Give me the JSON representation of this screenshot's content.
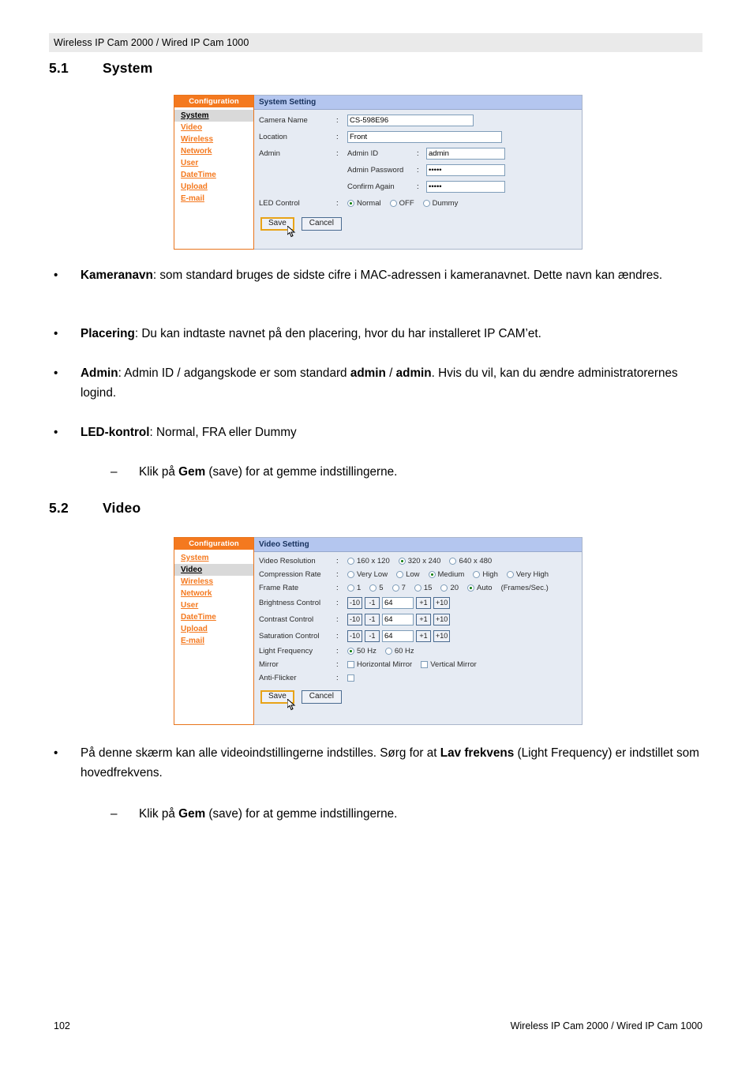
{
  "page": {
    "running_header": "Wireless IP Cam 2000 / Wired IP Cam 1000",
    "footer_page_number": "102",
    "footer_right": "Wireless IP Cam 2000 / Wired IP Cam 1000"
  },
  "sections": [
    {
      "number": "5.1",
      "title": "System"
    },
    {
      "number": "5.2",
      "title": "Video"
    }
  ],
  "colors": {
    "nav_orange": "#f4791f",
    "panel_title_blue": "#b4c6ef",
    "panel_bg": "#e6ebf3",
    "focus_gold": "#e8a317",
    "radio_dot_green": "#0a7a0a"
  },
  "system_screenshot": {
    "nav": {
      "title": "Configuration",
      "items": [
        {
          "label": "System",
          "active": true
        },
        {
          "label": "Video",
          "active": false
        },
        {
          "label": "Wireless",
          "active": false
        },
        {
          "label": "Network",
          "active": false
        },
        {
          "label": "User",
          "active": false
        },
        {
          "label": "DateTime",
          "active": false
        },
        {
          "label": "Upload",
          "active": false
        },
        {
          "label": "E-mail",
          "active": false
        }
      ]
    },
    "panel_title": "System Setting",
    "fields": {
      "camera_name_label": "Camera Name",
      "camera_name_value": "CS-598E96",
      "location_label": "Location",
      "location_value": "Front",
      "admin_label": "Admin",
      "admin_id_label": "Admin ID",
      "admin_id_value": "admin",
      "admin_password_label": "Admin Password",
      "admin_password_value": "•••••",
      "confirm_again_label": "Confirm Again",
      "confirm_again_value": "•••••",
      "led_control_label": "LED Control",
      "led_options": [
        {
          "label": "Normal",
          "selected": true
        },
        {
          "label": "OFF",
          "selected": false
        },
        {
          "label": "Dummy",
          "selected": false
        }
      ],
      "colon": ":"
    },
    "buttons": {
      "save": "Save",
      "cancel": "Cancel"
    }
  },
  "video_screenshot": {
    "nav": {
      "title": "Configuration",
      "items": [
        {
          "label": "System",
          "active": false
        },
        {
          "label": "Video",
          "active": true
        },
        {
          "label": "Wireless",
          "active": false
        },
        {
          "label": "Network",
          "active": false
        },
        {
          "label": "User",
          "active": false
        },
        {
          "label": "DateTime",
          "active": false
        },
        {
          "label": "Upload",
          "active": false
        },
        {
          "label": "E-mail",
          "active": false
        }
      ]
    },
    "panel_title": "Video Setting",
    "colon": ":",
    "rows": {
      "video_resolution_label": "Video Resolution",
      "video_resolution_options": [
        {
          "label": "160 x 120",
          "selected": false
        },
        {
          "label": "320 x 240",
          "selected": true
        },
        {
          "label": "640 x 480",
          "selected": false
        }
      ],
      "compression_rate_label": "Compression Rate",
      "compression_rate_options": [
        {
          "label": "Very Low",
          "selected": false
        },
        {
          "label": "Low",
          "selected": false
        },
        {
          "label": "Medium",
          "selected": true
        },
        {
          "label": "High",
          "selected": false
        },
        {
          "label": "Very High",
          "selected": false
        }
      ],
      "frame_rate_label": "Frame Rate",
      "frame_rate_options": [
        {
          "label": "1",
          "selected": false
        },
        {
          "label": "5",
          "selected": false
        },
        {
          "label": "7",
          "selected": false
        },
        {
          "label": "15",
          "selected": false
        },
        {
          "label": "20",
          "selected": false
        },
        {
          "label": "Auto",
          "selected": true
        }
      ],
      "frame_rate_unit": "(Frames/Sec.)",
      "brightness_label": "Brightness Control",
      "brightness_value": "64",
      "contrast_label": "Contrast Control",
      "contrast_value": "64",
      "saturation_label": "Saturation Control",
      "saturation_value": "64",
      "step_buttons": [
        "-10",
        "-1",
        "+1",
        "+10"
      ],
      "light_frequency_label": "Light Frequency",
      "light_frequency_options": [
        {
          "label": "50 Hz",
          "selected": true
        },
        {
          "label": "60 Hz",
          "selected": false
        }
      ],
      "mirror_label": "Mirror",
      "mirror_options": [
        {
          "label": "Horizontal Mirror",
          "checked": false
        },
        {
          "label": "Vertical Mirror",
          "checked": false
        }
      ],
      "anti_flicker_label": "Anti-Flicker",
      "anti_flicker_checked": false
    },
    "buttons": {
      "save": "Save",
      "cancel": "Cancel"
    }
  },
  "body_text": {
    "b1_mark": "•",
    "b1_strong": "Kameranavn",
    "b1_rest": ": som standard bruges de sidste cifre i MAC-adressen i kameranavnet. Dette navn kan ændres.",
    "b2_mark": "•",
    "b2_strong": "Placering",
    "b2_rest": ": Du kan indtaste navnet på den placering, hvor du har installeret IP CAM’et.",
    "b3_mark": "•",
    "b3_strong": "Admin",
    "b3_mid": ": Admin ID / adgangskode er som standard ",
    "b3_bold_a": "admin",
    "b3_sep": " / ",
    "b3_bold_b": "admin",
    "b3_tail": ". Hvis du vil, kan du ændre administratorernes logind.",
    "b4_mark": "•",
    "b4_strong": "LED-kontrol",
    "b4_rest": ": Normal, FRA eller Dummy",
    "b5_mark": "–",
    "b5_pre": "Klik på ",
    "b5_strong": "Gem",
    "b5_rest": " (save) for at gemme indstillingerne.",
    "b6_mark": "•",
    "b6_pre": "På denne skærm kan alle videoindstillingerne indstilles. Sørg for at ",
    "b6_strong": "Lav frekvens",
    "b6_rest": " (Light Frequency) er indstillet som hovedfrekvens.",
    "b7_mark": "–",
    "b7_pre": "Klik på ",
    "b7_strong": "Gem",
    "b7_rest": " (save) for at gemme indstillingerne."
  }
}
